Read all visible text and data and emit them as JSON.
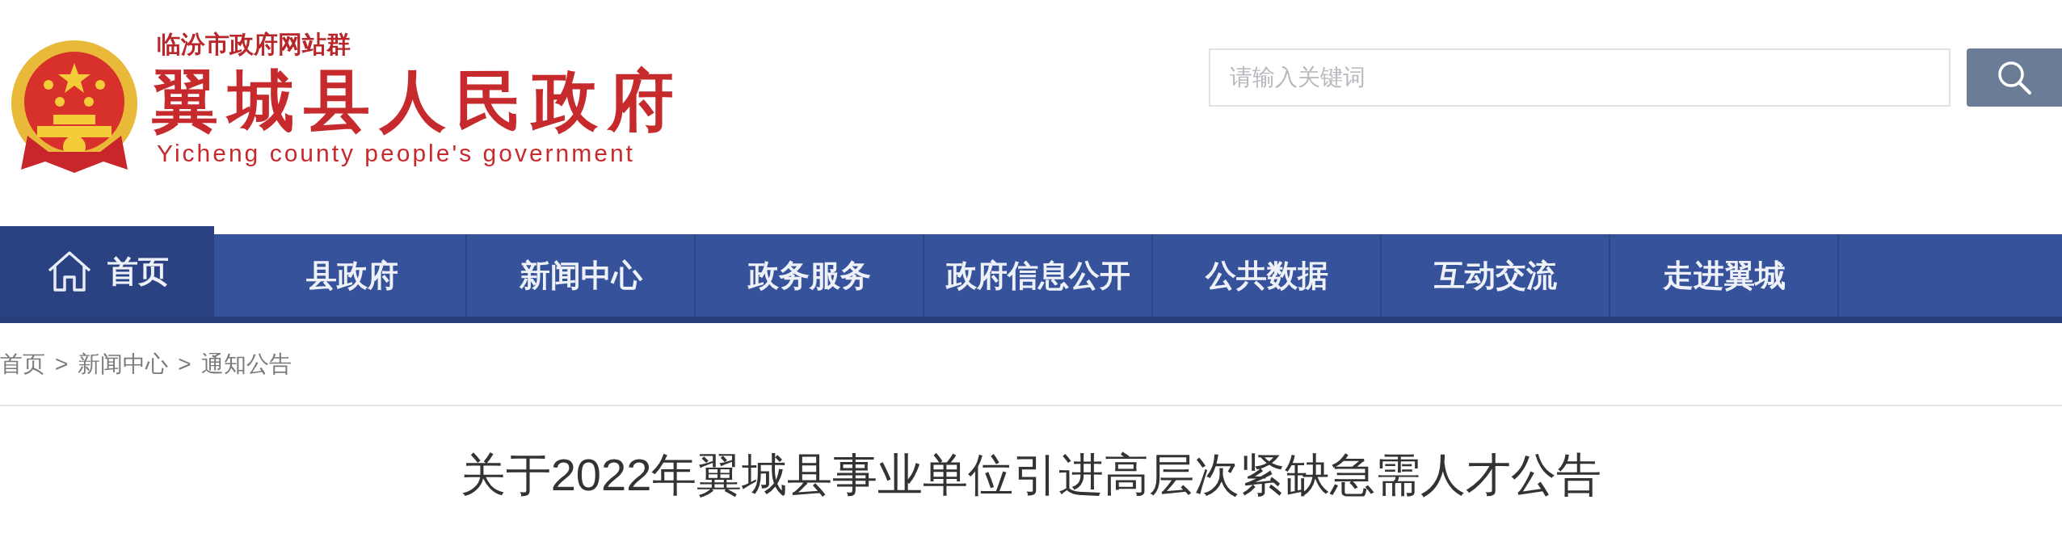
{
  "header": {
    "site_group": "临汾市政府网站群",
    "title": "翼城县人民政府",
    "subtitle": "Yicheng county people's government"
  },
  "search": {
    "placeholder": "请输入关键词"
  },
  "nav": [
    {
      "kind": "home",
      "label": "首页",
      "selected": true
    },
    {
      "kind": "link",
      "label": "县政府",
      "selected": false
    },
    {
      "kind": "link",
      "label": "新闻中心",
      "selected": false
    },
    {
      "kind": "link",
      "label": "政务服务",
      "selected": false
    },
    {
      "kind": "link",
      "label": "政府信息公开",
      "selected": false
    },
    {
      "kind": "link",
      "label": "公共数据",
      "selected": false
    },
    {
      "kind": "link",
      "label": "互动交流",
      "selected": false
    },
    {
      "kind": "link",
      "label": "走进翼城",
      "selected": false
    }
  ],
  "breadcrumb": {
    "links": [
      "首页",
      "新闻中心",
      "通知公告"
    ],
    "separators": [
      ">",
      ">"
    ]
  },
  "article": {
    "title": "关于2022年翼城县事业单位引进高层次紧缺急需人才公告"
  }
}
